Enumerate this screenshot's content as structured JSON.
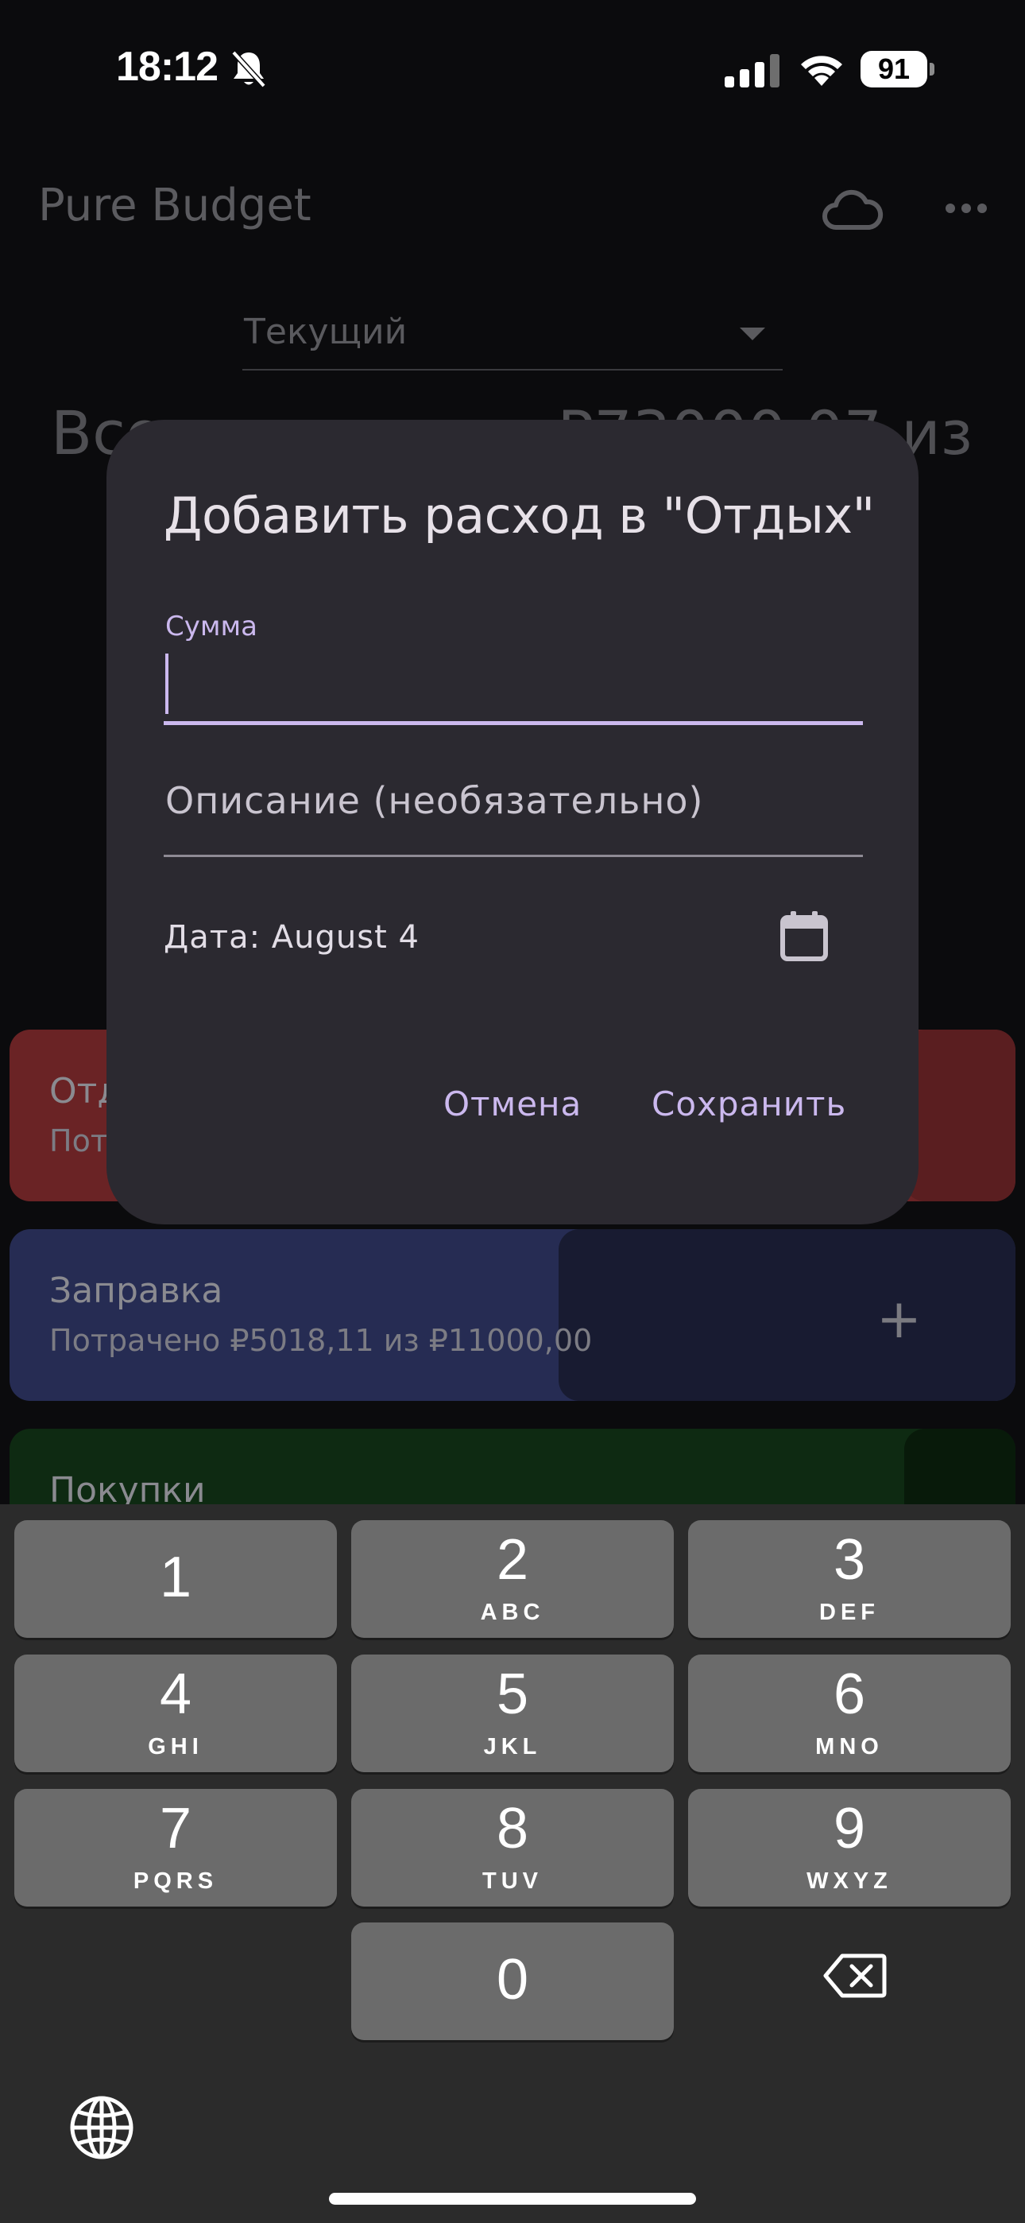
{
  "status_bar": {
    "time": "18:12",
    "battery": "91"
  },
  "app": {
    "title": "Pure Budget",
    "period": "Текущий",
    "total_left": "Все",
    "total_right": "₽73000,07 из",
    "budgets": [
      {
        "name": "Отдых",
        "spent_label": "Потрачено",
        "color": "#6a2325"
      },
      {
        "name": "Заправка",
        "spent_label": "Потрачено ₽5018,11 из ₽11000,00",
        "color": "#262c53"
      },
      {
        "name": "Покупки",
        "color": "#0e2a12"
      }
    ],
    "add_symbol": "+"
  },
  "dialog": {
    "title": "Добавить расход в \"Отдых\"",
    "amount_label": "Сумма",
    "amount_value": "",
    "description_placeholder": "Описание (необязательно)",
    "date_label": "Дата: August 4",
    "cancel_label": "Отмена",
    "save_label": "Сохранить",
    "accent_color": "#cbb8ee"
  },
  "keyboard": {
    "keys": [
      {
        "digit": "1",
        "letters": ""
      },
      {
        "digit": "2",
        "letters": "ABC"
      },
      {
        "digit": "3",
        "letters": "DEF"
      },
      {
        "digit": "4",
        "letters": "GHI"
      },
      {
        "digit": "5",
        "letters": "JKL"
      },
      {
        "digit": "6",
        "letters": "MNO"
      },
      {
        "digit": "7",
        "letters": "PQRS"
      },
      {
        "digit": "8",
        "letters": "TUV"
      },
      {
        "digit": "9",
        "letters": "WXYZ"
      },
      {
        "digit": "0",
        "letters": ""
      }
    ],
    "icons": [
      "backspace-icon",
      "globe-icon"
    ]
  }
}
